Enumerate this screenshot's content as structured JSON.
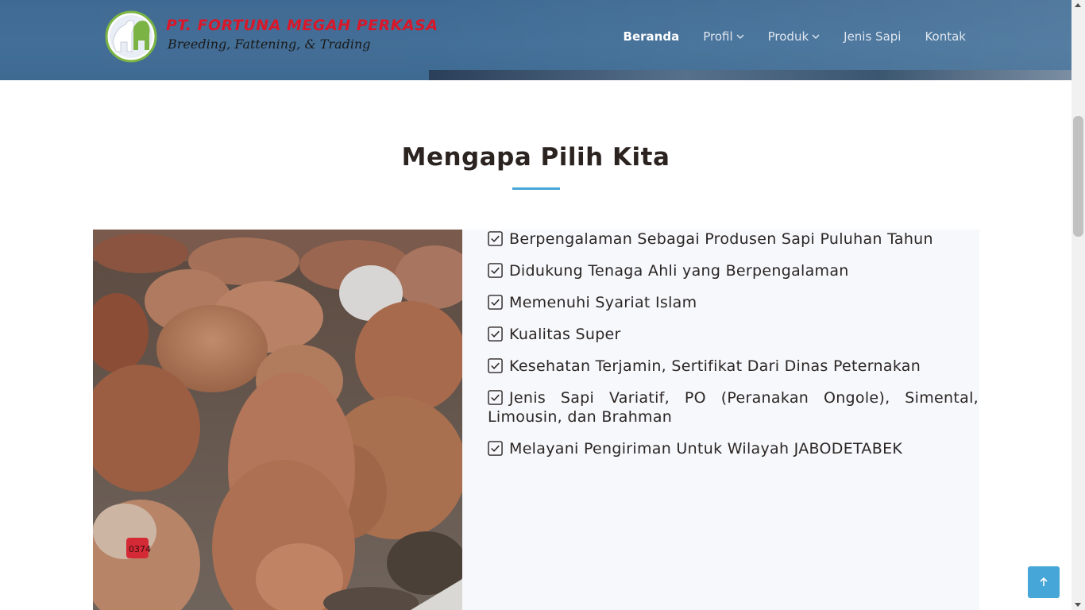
{
  "header": {
    "logo_title": "PT. FORTUNA MEGAH PERKASA",
    "logo_tagline": "Breeding, Fattening, & Trading",
    "nav": [
      {
        "label": "Beranda",
        "active": true
      },
      {
        "label": "Profil",
        "dropdown": true
      },
      {
        "label": "Produk",
        "dropdown": true
      },
      {
        "label": "Jenis Sapi"
      },
      {
        "label": "Kontak"
      }
    ]
  },
  "section": {
    "title": "Mengapa Pilih Kita",
    "features": [
      "Berpengalaman Sebagai Produsen Sapi Puluhan Tahun",
      "Didukung Tenaga Ahli yang Berpengalaman",
      "Memenuhi Syariat Islam",
      "Kualitas Super",
      "Kesehatan Terjamin, Sertifikat Dari Dinas Peternakan",
      "Jenis Sapi Variatif, PO (Peranakan Ongole), Simental, Limousin, dan Brahman",
      "Melayani Pengiriman Untuk Wilayah JABODETABEK"
    ],
    "photo_ear_tag": "0374"
  },
  "colors": {
    "header_bg": "#426f98",
    "accent": "#47a6d8",
    "logo_red": "#d8182a"
  },
  "icons": {
    "feature_icon": "check-square-icon",
    "back_to_top": "arrow-up-icon"
  }
}
